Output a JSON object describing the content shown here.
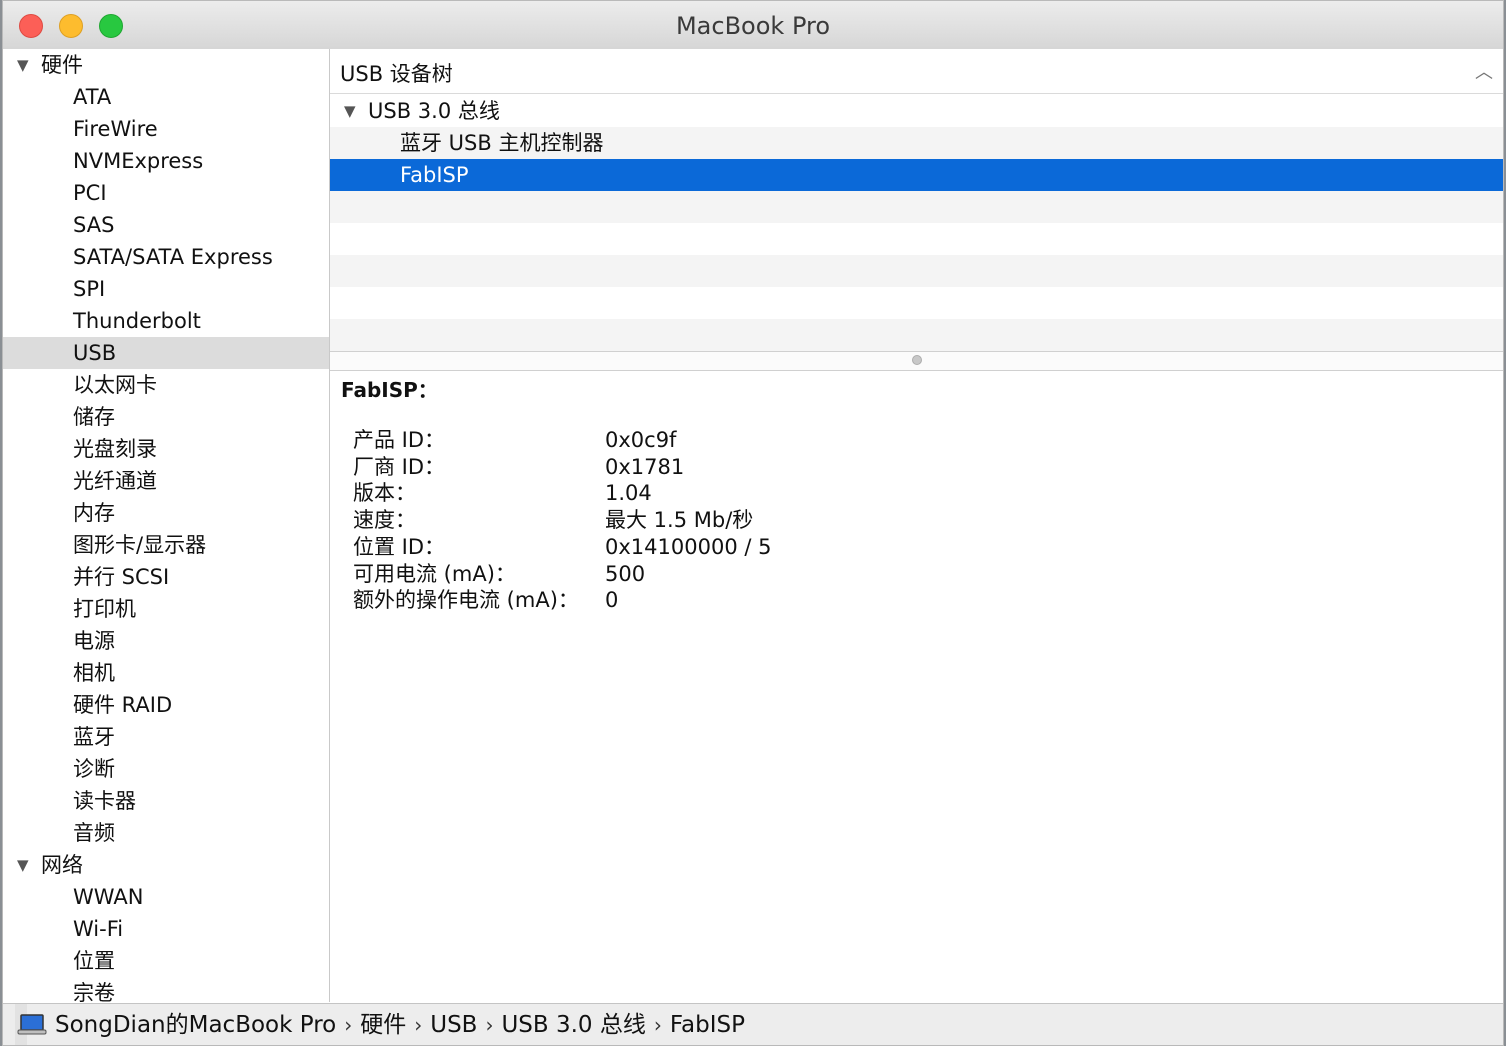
{
  "window": {
    "title": "MacBook Pro"
  },
  "sidebar": {
    "sections": [
      {
        "label": "硬件",
        "items": [
          "ATA",
          "FireWire",
          "NVMExpress",
          "PCI",
          "SAS",
          "SATA/SATA Express",
          "SPI",
          "Thunderbolt",
          "USB",
          "以太网卡",
          "储存",
          "光盘刻录",
          "光纤通道",
          "内存",
          "图形卡/显示器",
          "并行 SCSI",
          "打印机",
          "电源",
          "相机",
          "硬件 RAID",
          "蓝牙",
          "诊断",
          "读卡器",
          "音频"
        ]
      },
      {
        "label": "网络",
        "items": [
          "WWAN",
          "Wi-Fi",
          "位置",
          "宗卷"
        ]
      }
    ],
    "selected": "USB"
  },
  "usb_tree": {
    "header": "USB 设备树",
    "bus": "USB 3.0 总线",
    "devices": [
      "蓝牙 USB 主机控制器",
      "FabISP"
    ],
    "selected": "FabISP"
  },
  "detail": {
    "title": "FabISP：",
    "properties": [
      {
        "key": "产品 ID：",
        "value": "0x0c9f"
      },
      {
        "key": "厂商 ID：",
        "value": "0x1781"
      },
      {
        "key": "版本：",
        "value": "1.04"
      },
      {
        "key": "速度：",
        "value": "最大 1.5 Mb/秒"
      },
      {
        "key": "位置 ID：",
        "value": "0x14100000 / 5"
      },
      {
        "key": "可用电流 (mA)：",
        "value": "500"
      },
      {
        "key": "额外的操作电流 (mA)：",
        "value": "0"
      }
    ]
  },
  "pathbar": {
    "crumbs": [
      "SongDian的MacBook Pro",
      "硬件",
      "USB",
      "USB 3.0 总线",
      "FabISP"
    ],
    "separator": "›"
  },
  "colors": {
    "selection": "#0b69d8",
    "sidebar_selection": "#dcdcdc",
    "close": "#fc5f57",
    "minimize": "#fdbc2e",
    "zoom": "#28c840"
  }
}
